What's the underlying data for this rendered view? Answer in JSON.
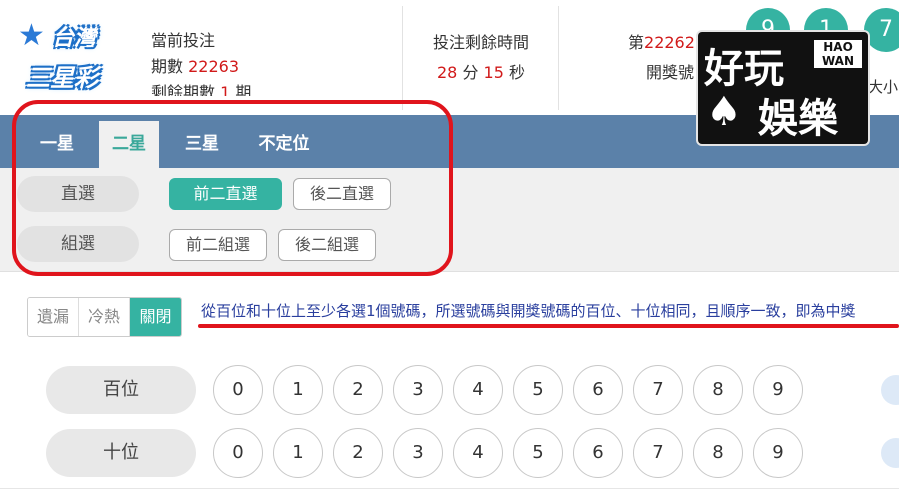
{
  "logo": {
    "line1": "台灣",
    "line2": "三星彩"
  },
  "header": {
    "current_label": "當前投注",
    "period_label": "期數",
    "period_value": "22263",
    "remaining_label": "剩餘期數",
    "remaining_value": "1",
    "remaining_unit": "期",
    "countdown_title": "投注剩餘時間",
    "minutes": "28",
    "minutes_unit": "分",
    "seconds": "15",
    "seconds_unit": "秒",
    "draw_prefix": "第",
    "draw_issue": "22262",
    "draw_label": "開獎號",
    "balls": [
      "9",
      "1",
      "7"
    ],
    "size_label": "大小"
  },
  "watermark": {
    "line1": "好玩",
    "line2": "娛樂",
    "brand": "HAO WAN",
    "cards": "♠"
  },
  "tabs": [
    {
      "label": "一星",
      "active": false
    },
    {
      "label": "二星",
      "active": true
    },
    {
      "label": "三星",
      "active": false
    },
    {
      "label": "不定位",
      "active": false
    }
  ],
  "play_types": [
    {
      "label": "直選",
      "options": [
        {
          "label": "前二直選",
          "selected": true
        },
        {
          "label": "後二直選",
          "selected": false
        }
      ]
    },
    {
      "label": "組選",
      "options": [
        {
          "label": "前二組選",
          "selected": false
        },
        {
          "label": "後二組選",
          "selected": false
        }
      ]
    }
  ],
  "toggles": [
    {
      "label": "遺漏",
      "active": false
    },
    {
      "label": "冷熱",
      "active": false
    },
    {
      "label": "關閉",
      "active": true
    }
  ],
  "description": "從百位和十位上至少各選1個號碼，所選號碼與開獎號碼的百位、十位相同，且順序一致，即為中獎",
  "rows": [
    {
      "label": "百位",
      "numbers": [
        "0",
        "1",
        "2",
        "3",
        "4",
        "5",
        "6",
        "7",
        "8",
        "9"
      ]
    },
    {
      "label": "十位",
      "numbers": [
        "0",
        "1",
        "2",
        "3",
        "4",
        "5",
        "6",
        "7",
        "8",
        "9"
      ]
    }
  ],
  "colors": {
    "accent": "#35b3a2",
    "tabbar": "#5b81a9",
    "highlight": "#d11a1a",
    "annotation": "#e0141c"
  }
}
